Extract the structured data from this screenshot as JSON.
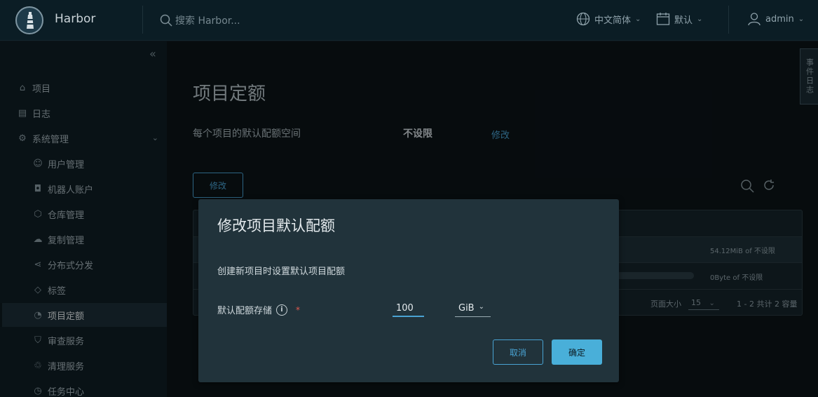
{
  "header": {
    "brand": "Harbor",
    "search_placeholder": "搜索 Harbor...",
    "language": "中文简体",
    "date_format": "默认",
    "user": "admin",
    "side_tab": "事件日志"
  },
  "sidebar": {
    "items": [
      {
        "label": "项目",
        "icon": "projects-icon"
      },
      {
        "label": "日志",
        "icon": "logs-icon"
      },
      {
        "label": "系统管理",
        "icon": "admin-icon"
      },
      {
        "label": "用户管理",
        "icon": "users-icon"
      },
      {
        "label": "机器人账户",
        "icon": "robot-icon"
      },
      {
        "label": "仓库管理",
        "icon": "registry-icon"
      },
      {
        "label": "复制管理",
        "icon": "cloud-icon"
      },
      {
        "label": "分布式分发",
        "icon": "share-icon"
      },
      {
        "label": "标签",
        "icon": "tag-icon"
      },
      {
        "label": "项目定额",
        "icon": "gauge-icon"
      },
      {
        "label": "审查服务",
        "icon": "shield-icon"
      },
      {
        "label": "清理服务",
        "icon": "trash-icon"
      },
      {
        "label": "任务中心",
        "icon": "clock-icon"
      }
    ],
    "active_index": 9
  },
  "main": {
    "title": "项目定额",
    "default_label": "每个项目的默认配额空间",
    "default_value": "不设限",
    "edit_link": "修改",
    "edit_button": "修改",
    "rows": [
      {
        "quota_text": "54.12MiB of 不设限"
      },
      {
        "quota_text": "0Byte of 不设限"
      }
    ],
    "footer": {
      "page_size_label": "页面大小",
      "page_size": "15",
      "summary": "1 - 2 共计 2 容量"
    }
  },
  "modal": {
    "title": "修改项目默认配额",
    "description": "创建新项目时设置默认项目配额",
    "field_label": "默认配额存储",
    "required_mark": "*",
    "info": "i",
    "quota_value": "100",
    "unit": "GiB",
    "cancel": "取消",
    "confirm": "确定"
  },
  "colors": {
    "accent": "#49afd9",
    "background": "#0c1418",
    "modal_background": "#21333b"
  }
}
